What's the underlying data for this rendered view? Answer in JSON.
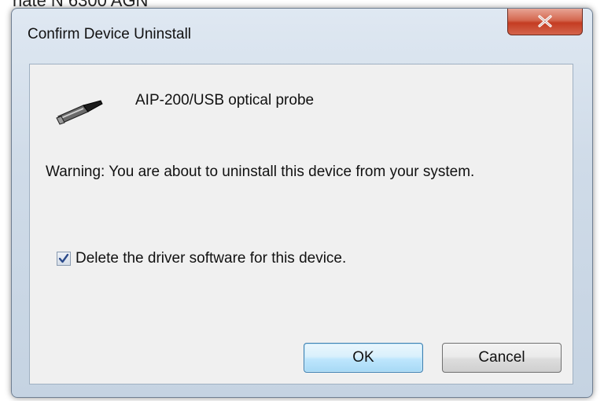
{
  "background": {
    "top_text": "hate N 6300 AGN"
  },
  "dialog": {
    "title": "Confirm Device Uninstall",
    "close_icon": "close-icon",
    "device_icon": "usb-connector-icon",
    "device_name": "AIP-200/USB optical probe",
    "warning_text": "Warning: You are about to uninstall this device from your system.",
    "checkbox": {
      "label": "Delete the driver software for this device.",
      "checked": true
    },
    "buttons": {
      "ok_label": "OK",
      "cancel_label": "Cancel"
    }
  },
  "colors": {
    "close_button": "#c43c22",
    "ok_button_border": "#3c7fb1",
    "client_background": "#f0f0f0"
  }
}
